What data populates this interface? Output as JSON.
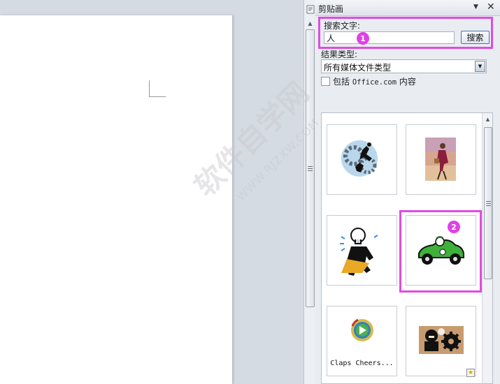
{
  "pane": {
    "title": "剪贴画",
    "menu_icon": "dropdown-arrow-icon",
    "close_icon": "close-icon"
  },
  "search": {
    "label": "搜索文字:",
    "value": "人",
    "button": "搜索",
    "highlight_color": "#e14be0"
  },
  "results_type": {
    "label": "结果类型:",
    "selected": "所有媒体文件类型"
  },
  "include": {
    "prefix": "包括 ",
    "office": "Office.com",
    "suffix": " 内容",
    "checked": false
  },
  "badges": {
    "one": "1",
    "two": "2"
  },
  "clipart": [
    {
      "name": "gears-people"
    },
    {
      "name": "woman-walking"
    },
    {
      "name": "lightbulb-man"
    },
    {
      "name": "green-car"
    },
    {
      "name": "claps-cheers",
      "label": "Claps Cheers..."
    },
    {
      "name": "gear-silhouette"
    }
  ],
  "watermark": {
    "text": "软件自学网",
    "url": "WWW.RJZXW.COM"
  }
}
